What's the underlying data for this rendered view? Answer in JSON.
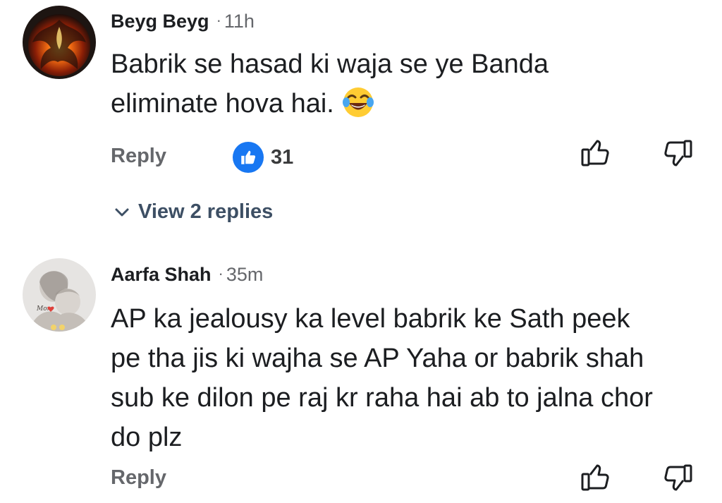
{
  "comments": [
    {
      "author": "Beyg Beyg",
      "separator": "·",
      "time": "11h",
      "lines": [
        "Babrik se hasad ki waja se ye Banda",
        "eliminate hova hai."
      ],
      "emoji": "face-with-tears-of-joy",
      "reply_label": "Reply",
      "reaction_count": "31",
      "view_replies_label": "View 2 replies"
    },
    {
      "author": "Aarfa Shah",
      "separator": "·",
      "time": "35m",
      "lines": [
        "AP ka jealousy ka level babrik ke Sath peek",
        "pe tha jis ki wajha se AP Yaha or babrik shah",
        "sub ke dilon pe raj kr raha hai ab to jalna chor",
        "do plz"
      ],
      "reply_label": "Reply"
    }
  ],
  "colors": {
    "like_blue": "#1877f2",
    "secondary_text": "#65676b",
    "primary_text": "#1c1e21"
  }
}
